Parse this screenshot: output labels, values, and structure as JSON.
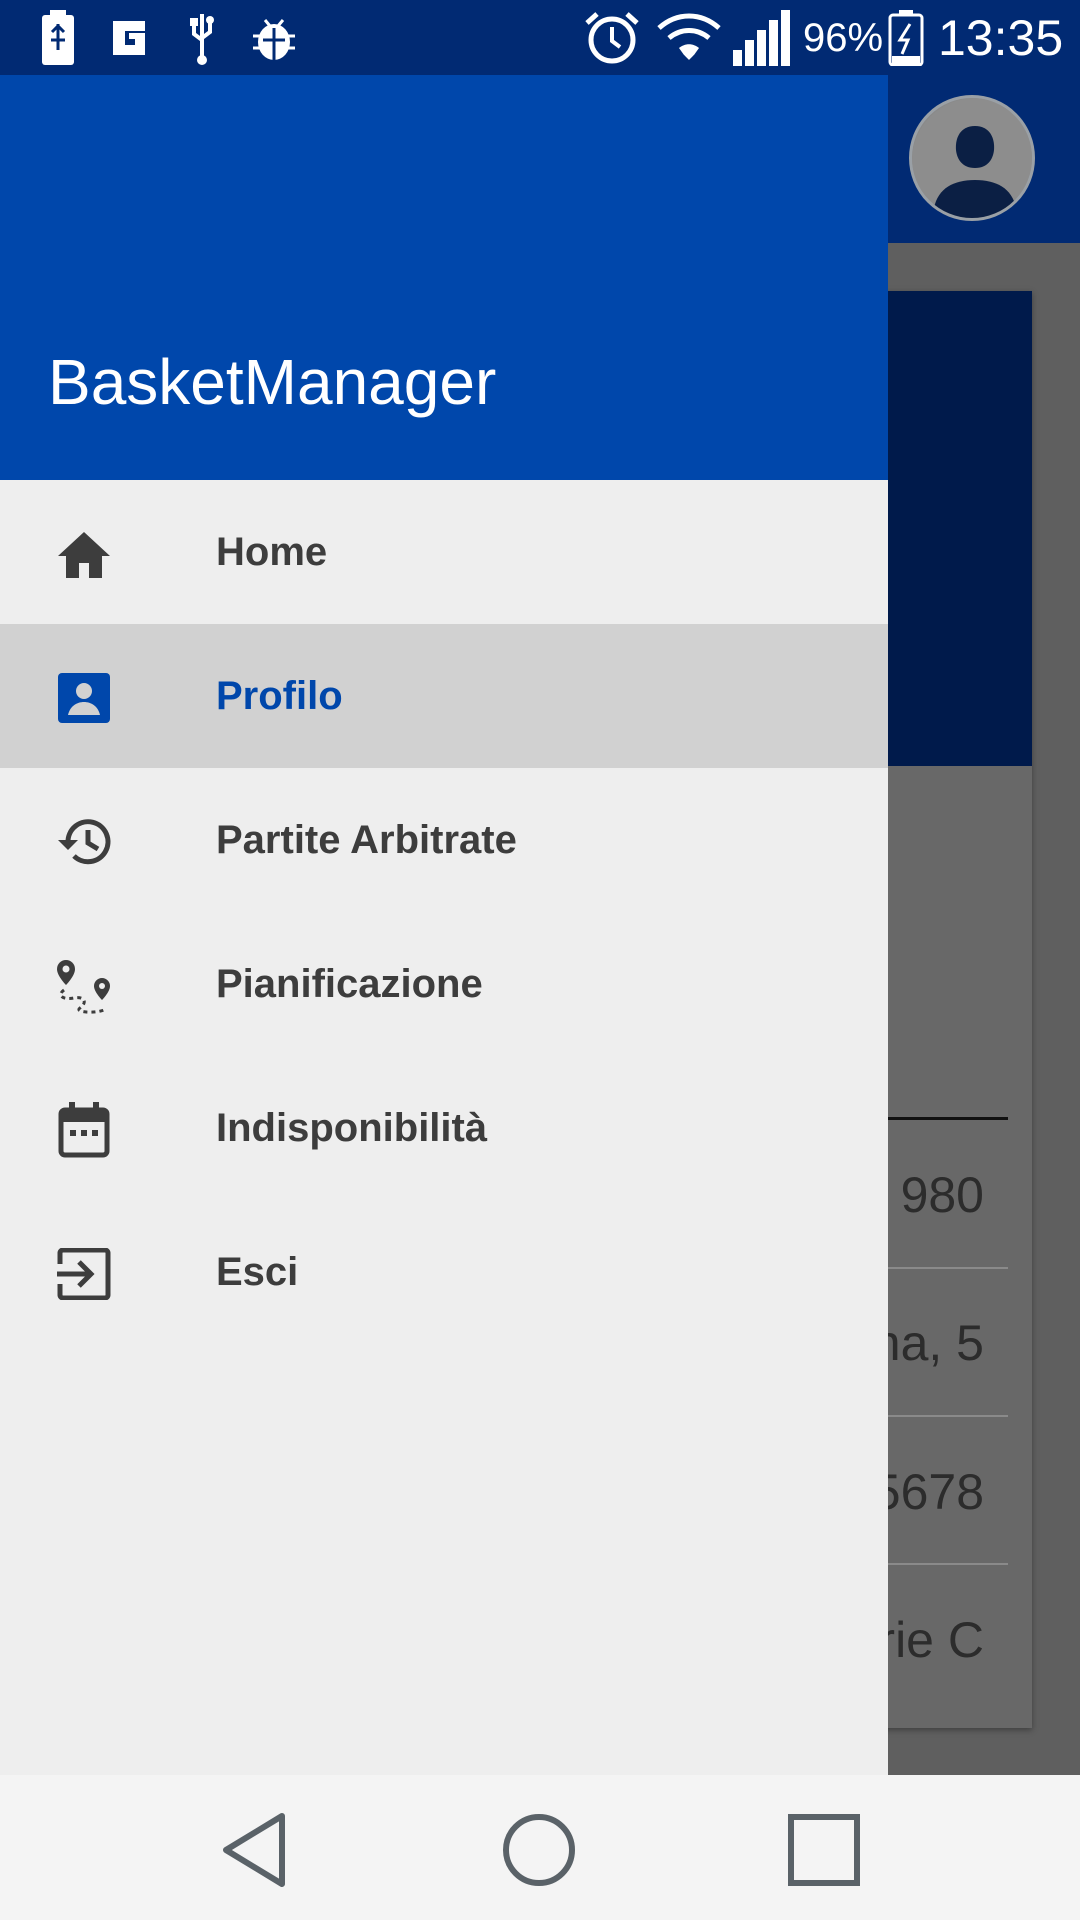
{
  "status_bar": {
    "battery_percent": "96%",
    "time": "13:35",
    "icons": [
      "battery-usb-icon",
      "g-app-icon",
      "usb-icon",
      "bug-icon",
      "alarm-icon",
      "wifi-icon",
      "signal-icon",
      "battery-charging-icon"
    ]
  },
  "drawer": {
    "title": "BasketManager",
    "header_color": "#0047ab",
    "items": [
      {
        "label": "Home",
        "icon": "home-icon",
        "active": false
      },
      {
        "label": "Profilo",
        "icon": "account-box-icon",
        "active": true
      },
      {
        "label": "Partite Arbitrate",
        "icon": "history-icon",
        "active": false
      },
      {
        "label": "Pianificazione",
        "icon": "route-icon",
        "active": false
      },
      {
        "label": "Indisponibilità",
        "icon": "calendar-icon",
        "active": false
      },
      {
        "label": "Esci",
        "icon": "exit-icon",
        "active": false
      }
    ]
  },
  "background": {
    "rows": [
      "980",
      "na, 5",
      "5678",
      "rie C"
    ]
  },
  "nav_bar": {
    "buttons": [
      "back-icon",
      "home-circle-icon",
      "recents-icon"
    ]
  },
  "colors": {
    "primary": "#0047ab",
    "status_bar": "#012a73",
    "active_item_bg": "#d1d1d1"
  }
}
